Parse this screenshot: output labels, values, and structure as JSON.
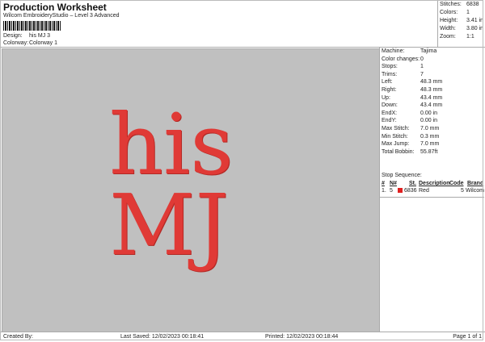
{
  "header": {
    "title": "Production Worksheet",
    "subtitle": "Wilcom EmbroideryStudio – Level 3 Advanced",
    "design_label": "Design:",
    "design": "his MJ 3",
    "colorway_label": "Colorway:",
    "colorway": "Colorway 1"
  },
  "summary": [
    {
      "k": "Stitches:",
      "v": "6838"
    },
    {
      "k": "Colors:",
      "v": "1"
    },
    {
      "k": "Height:",
      "v": "3.41 in"
    },
    {
      "k": "Width:",
      "v": "3.80 in"
    },
    {
      "k": "Zoom:",
      "v": "1:1"
    }
  ],
  "design_text": {
    "line1": "his",
    "line2": "MJ",
    "thread_color": "#e03a36"
  },
  "details": [
    {
      "k": "Machine:",
      "v": "Tajima"
    },
    {
      "k": "Color changes:",
      "v": "0"
    },
    {
      "k": "Stops:",
      "v": "1"
    },
    {
      "k": "Trims:",
      "v": "7"
    },
    {
      "k": "Left:",
      "v": "48.3 mm"
    },
    {
      "k": "Right:",
      "v": "48.3 mm"
    },
    {
      "k": "Up:",
      "v": "43.4 mm"
    },
    {
      "k": "Down:",
      "v": "43.4 mm"
    },
    {
      "k": "EndX:",
      "v": "0.00 in"
    },
    {
      "k": "EndY:",
      "v": "0.00 in"
    },
    {
      "k": "Max Stitch:",
      "v": "7.0 mm"
    },
    {
      "k": "Min Stitch:",
      "v": "0.3 mm"
    },
    {
      "k": "Max Jump:",
      "v": "7.0 mm"
    },
    {
      "k": "Total Bobbin:",
      "v": "55.87ft"
    }
  ],
  "stop_sequence": {
    "label": "Stop Sequence:",
    "headers": [
      "#",
      "N#",
      "St.",
      "Description",
      "Code",
      "Brand"
    ],
    "rows": [
      {
        "num": "1.",
        "n": "5",
        "color": "#e02020",
        "st": "6836",
        "desc": "Red",
        "code": "5",
        "brand": "Wilcom"
      }
    ]
  },
  "footer": {
    "created": "Created By:",
    "saved": "Last Saved: 12/02/2023 00:18:41",
    "printed": "Printed: 12/02/2023 00:18:44",
    "page": "Page 1 of 1"
  }
}
